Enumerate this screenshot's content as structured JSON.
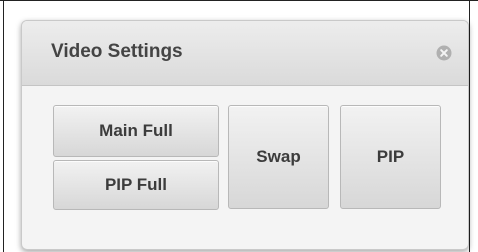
{
  "dialog": {
    "title": "Video Settings",
    "close_icon": "close-circle-icon"
  },
  "buttons": {
    "main_full": "Main Full",
    "pip_full": "PIP Full",
    "swap": "Swap",
    "pip": "PIP"
  }
}
